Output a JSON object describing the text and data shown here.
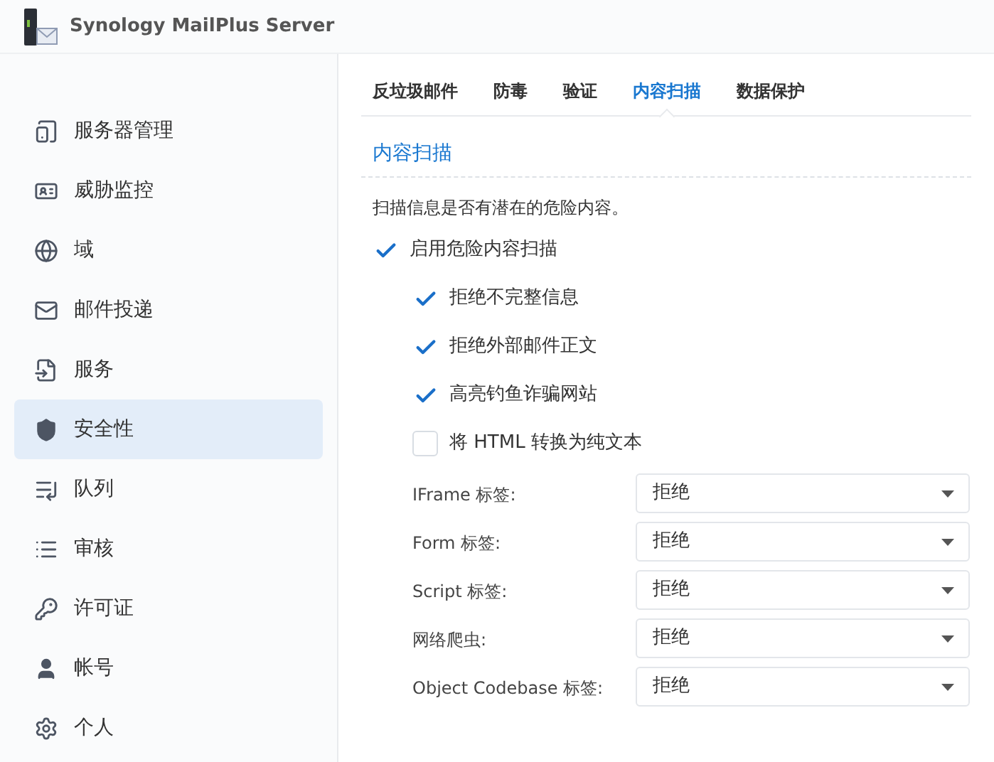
{
  "app": {
    "title": "Synology MailPlus Server"
  },
  "sidebar": {
    "items": [
      {
        "label": "服务器管理",
        "selected": false
      },
      {
        "label": "威胁监控",
        "selected": false
      },
      {
        "label": "域",
        "selected": false
      },
      {
        "label": "邮件投递",
        "selected": false
      },
      {
        "label": "服务",
        "selected": false
      },
      {
        "label": "安全性",
        "selected": true
      },
      {
        "label": "队列",
        "selected": false
      },
      {
        "label": "审核",
        "selected": false
      },
      {
        "label": "许可证",
        "selected": false
      },
      {
        "label": "帐号",
        "selected": false
      },
      {
        "label": "个人",
        "selected": false
      }
    ]
  },
  "tabs": [
    {
      "label": "反垃圾邮件",
      "selected": false
    },
    {
      "label": "防毒",
      "selected": false
    },
    {
      "label": "验证",
      "selected": false
    },
    {
      "label": "内容扫描",
      "selected": true
    },
    {
      "label": "数据保护",
      "selected": false
    }
  ],
  "section": {
    "title": "内容扫描",
    "description": "扫描信息是否有潜在的危险内容。",
    "main_option": {
      "label": "启用危险内容扫描",
      "checked": true,
      "children": [
        {
          "label": "拒绝不完整信息",
          "checked": true
        },
        {
          "label": "拒绝外部邮件正文",
          "checked": true
        },
        {
          "label": "高亮钓鱼诈骗网站",
          "checked": true
        },
        {
          "label": "将 HTML 转换为纯文本",
          "checked": false
        }
      ]
    },
    "selects": [
      {
        "label": "IFrame 标签:",
        "value": "拒绝"
      },
      {
        "label": "Form 标签:",
        "value": "拒绝"
      },
      {
        "label": "Script 标签:",
        "value": "拒绝"
      },
      {
        "label": "网络爬虫:",
        "value": "拒绝"
      },
      {
        "label": "Object Codebase 标签:",
        "value": "拒绝"
      }
    ]
  }
}
